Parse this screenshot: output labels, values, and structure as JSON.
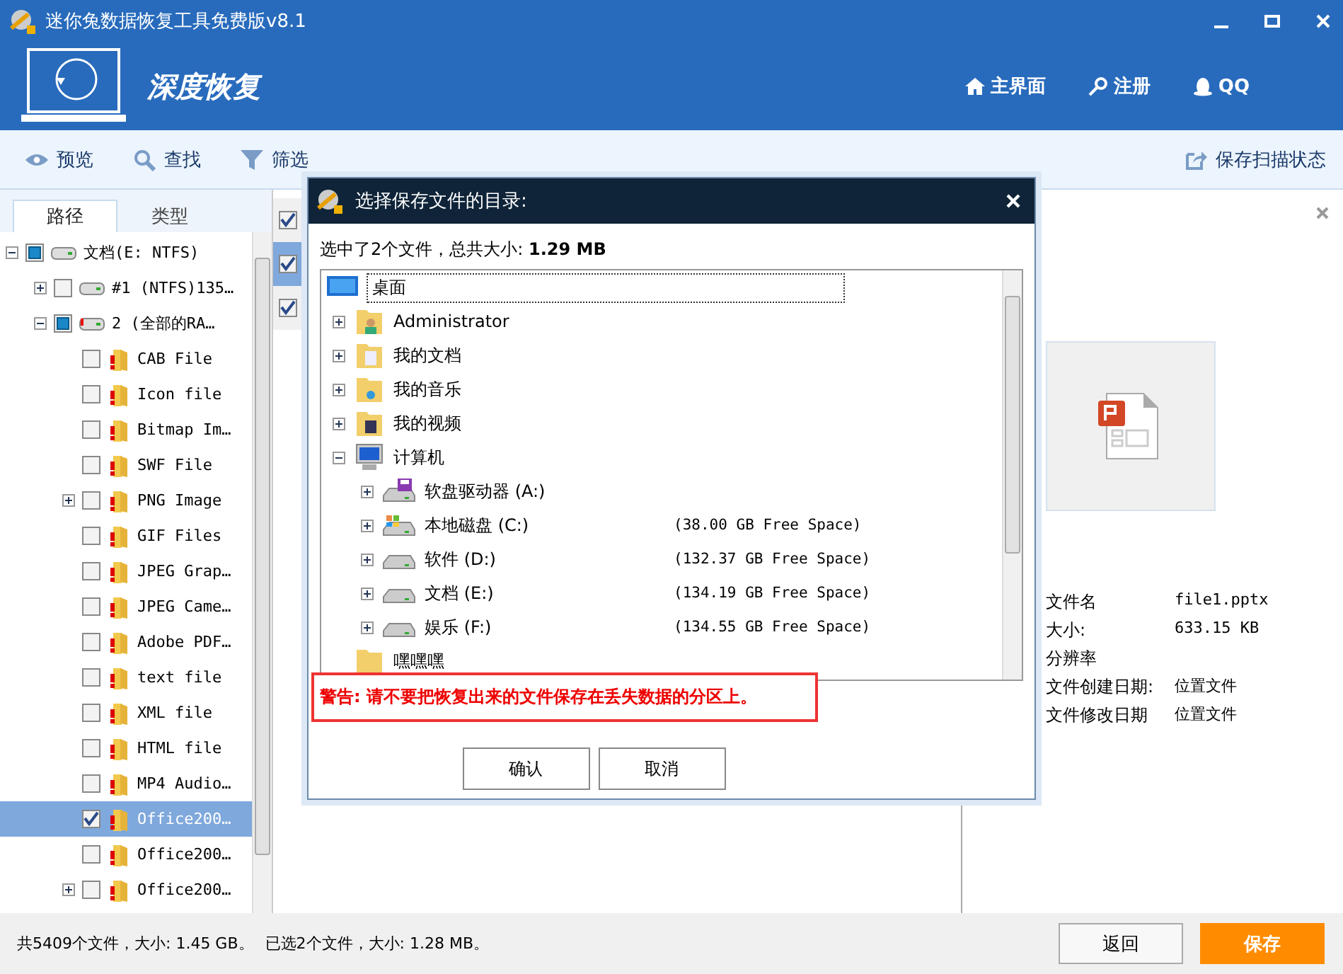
{
  "window": {
    "title": "迷你兔数据恢复工具免费版v8.1"
  },
  "header": {
    "mode_title": "深度恢复",
    "links": [
      {
        "kind": "home",
        "label": "主界面"
      },
      {
        "kind": "key",
        "label": "注册"
      },
      {
        "kind": "qq",
        "label": "QQ"
      }
    ]
  },
  "toolbar": {
    "items": [
      {
        "kind": "eye",
        "label": "预览"
      },
      {
        "kind": "search",
        "label": "查找"
      },
      {
        "kind": "filter",
        "label": "筛选"
      }
    ],
    "save_scan": "保存扫描状态"
  },
  "tabs": [
    {
      "label": "路径",
      "selected": true
    },
    {
      "label": "类型",
      "selected": false
    }
  ],
  "tree": [
    {
      "label": "文档(E: NTFS)",
      "kind": "drive",
      "checked": false,
      "partial": true,
      "expanded": true,
      "selected": false,
      "children": [
        {
          "label": "#1 (NTFS)135…",
          "kind": "drive",
          "checked": false,
          "partial": false,
          "expanded": false,
          "selected": false
        },
        {
          "label": "2 (全部的RA…",
          "kind": "lost-drive",
          "checked": false,
          "partial": true,
          "expanded": true,
          "selected": false,
          "children": [
            {
              "label": "CAB File",
              "kind": "folder",
              "checked": false,
              "partial": false,
              "selected": false
            },
            {
              "label": "Icon file",
              "kind": "folder",
              "checked": false,
              "partial": false,
              "selected": false
            },
            {
              "label": "Bitmap Im…",
              "kind": "folder",
              "checked": false,
              "partial": false,
              "selected": false
            },
            {
              "label": "SWF File",
              "kind": "folder",
              "checked": false,
              "partial": false,
              "selected": false
            },
            {
              "label": "PNG Image",
              "kind": "folder",
              "checked": false,
              "partial": false,
              "expanded": false,
              "selected": false
            },
            {
              "label": "GIF Files",
              "kind": "folder",
              "checked": false,
              "partial": false,
              "selected": false
            },
            {
              "label": "JPEG Grap…",
              "kind": "folder",
              "checked": false,
              "partial": false,
              "selected": false
            },
            {
              "label": "JPEG Came…",
              "kind": "folder",
              "checked": false,
              "partial": false,
              "selected": false
            },
            {
              "label": "Adobe PDF…",
              "kind": "folder",
              "checked": false,
              "partial": false,
              "selected": false
            },
            {
              "label": "text file",
              "kind": "folder",
              "checked": false,
              "partial": false,
              "selected": false
            },
            {
              "label": "XML file",
              "kind": "folder",
              "checked": false,
              "partial": false,
              "selected": false
            },
            {
              "label": "HTML file",
              "kind": "folder",
              "checked": false,
              "partial": false,
              "selected": false
            },
            {
              "label": "MP4 Audio…",
              "kind": "folder",
              "checked": false,
              "partial": false,
              "selected": false
            },
            {
              "label": "Office200…",
              "kind": "folder",
              "checked": true,
              "partial": false,
              "selected": true
            },
            {
              "label": "Office200…",
              "kind": "folder",
              "checked": false,
              "partial": false,
              "selected": false
            },
            {
              "label": "Office200…",
              "kind": "folder",
              "checked": false,
              "partial": false,
              "expanded": false,
              "selected": false
            }
          ]
        }
      ]
    }
  ],
  "file_list": [
    {
      "checked": true,
      "selected": false
    },
    {
      "checked": true,
      "selected": true
    },
    {
      "checked": true,
      "selected": false
    }
  ],
  "preview": {
    "details": [
      {
        "label": "文件名",
        "value": "file1.pptx"
      },
      {
        "label": "大小:",
        "value": "633.15 KB"
      },
      {
        "label": "分辨率"
      },
      {
        "label": "文件创建日期:",
        "value": "位置文件"
      },
      {
        "label": "文件修改日期",
        "value": "位置文件"
      }
    ]
  },
  "dialog": {
    "title": "选择保存文件的目录:",
    "summary": "选中了2个文件，总共大小: **1.29 MB**",
    "tree": [
      {
        "label": "桌面",
        "kind": "desktop",
        "selected": true,
        "children": [
          {
            "label": "Administrator",
            "kind": "user-folder",
            "expanded": false
          },
          {
            "label": "我的文档",
            "kind": "doc-folder",
            "expanded": false
          },
          {
            "label": "我的音乐",
            "kind": "music-folder",
            "expanded": false
          },
          {
            "label": "我的视频",
            "kind": "video-folder",
            "expanded": false
          },
          {
            "label": "计算机",
            "kind": "computer",
            "expanded": true,
            "children": [
              {
                "label": "软盘驱动器 (A:)",
                "kind": "floppy",
                "expanded": false
              },
              {
                "label": "本地磁盘 (C:)",
                "kind": "system-drive",
                "free": "(38.00 GB Free Space)",
                "expanded": false
              },
              {
                "label": "软件 (D:)",
                "kind": "drive",
                "free": "(132.37 GB Free Space)",
                "expanded": false
              },
              {
                "label": "文档 (E:)",
                "kind": "drive",
                "free": "(134.19 GB Free Space)",
                "expanded": false
              },
              {
                "label": "娱乐 (F:)",
                "kind": "drive",
                "free": "(134.55 GB Free Space)",
                "expanded": false
              }
            ]
          },
          {
            "label": "嘿嘿嘿",
            "kind": "folder"
          }
        ]
      }
    ],
    "warning": "警告: 请不要把恢复出来的文件保存在丢失数据的分区上。",
    "buttons": [
      "确认",
      "取消"
    ]
  },
  "status_bar": {
    "total": "共5409个文件，大小: 1.45 GB。",
    "selected": "已选2个文件，大小: 1.28 MB。"
  },
  "actions": [
    {
      "kind": "secondary",
      "label": "返回"
    },
    {
      "kind": "primary",
      "label": "保存"
    }
  ]
}
